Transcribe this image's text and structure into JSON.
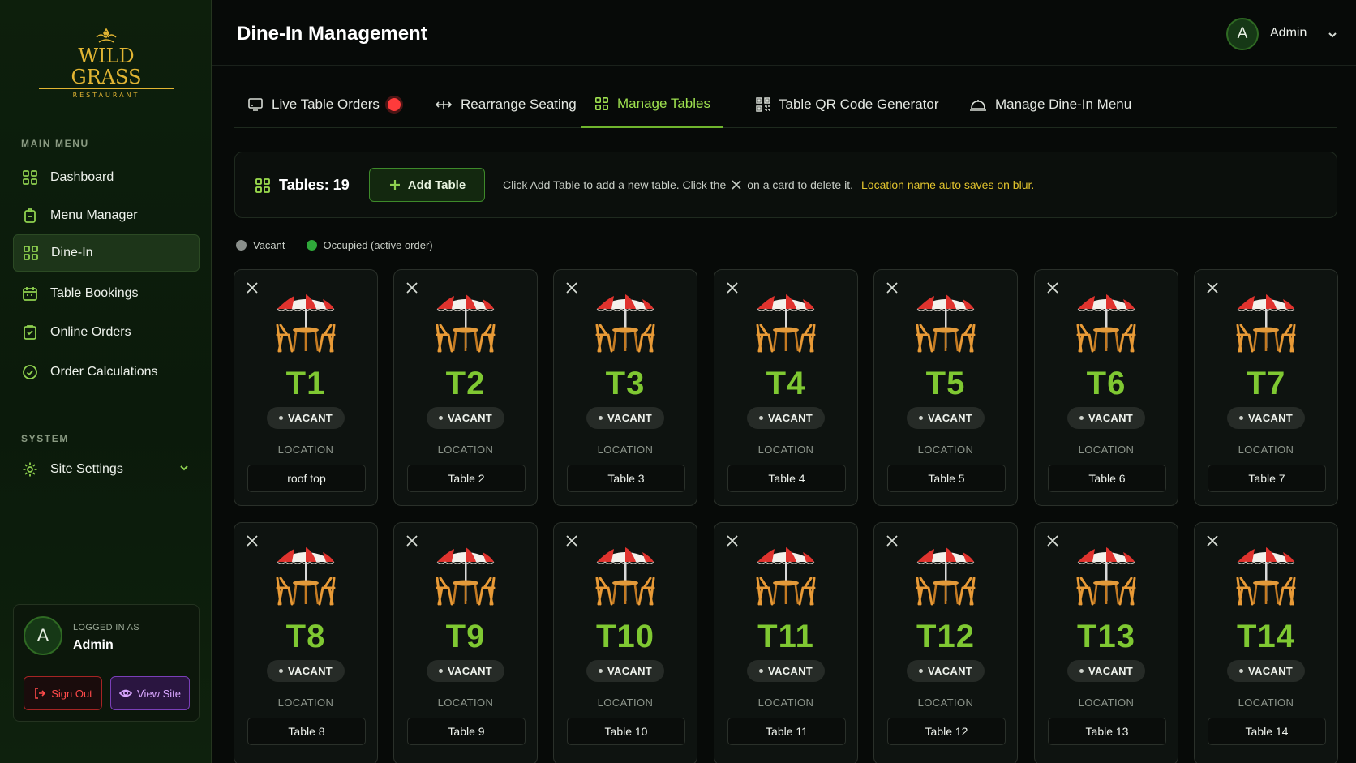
{
  "brand": {
    "name": "WILD GRASS",
    "sub": "RESTAURANT",
    "gold": "#e2b533"
  },
  "sidebar": {
    "main_label": "MAIN MENU",
    "items": [
      {
        "label": "Dashboard",
        "icon": "grid-icon"
      },
      {
        "label": "Menu Manager",
        "icon": "clipboard-icon"
      },
      {
        "label": "Dine-In",
        "icon": "grid-icon",
        "active": true
      },
      {
        "label": "Table Bookings",
        "icon": "calendar-icon"
      },
      {
        "label": "Online Orders",
        "icon": "clipboard-check-icon"
      },
      {
        "label": "Order Calculations",
        "icon": "check-circle-icon"
      }
    ],
    "system_label": "SYSTEM",
    "settings": {
      "label": "Site Settings",
      "icon": "gear-icon"
    },
    "user": {
      "initial": "A",
      "logged_label": "LOGGED IN AS",
      "name": "Admin",
      "signout": "Sign Out",
      "viewsite": "View Site"
    }
  },
  "header": {
    "title": "Dine-In Management",
    "admin_initial": "A",
    "admin_name": "Admin"
  },
  "tabs": [
    {
      "label": "Live Table Orders",
      "icon": "monitor-icon"
    },
    {
      "label": "Rearrange Seating",
      "icon": "arrows-icon"
    },
    {
      "label": "Manage Tables",
      "icon": "grid-icon",
      "active": true
    },
    {
      "label": "Table QR Code Generator",
      "icon": "qr-icon"
    },
    {
      "label": "Manage Dine-In Menu",
      "icon": "cloche-icon"
    }
  ],
  "infobar": {
    "tables_label": "Tables: 19",
    "add_label": "Add Table",
    "help_before": "Click Add Table to add a new table. Click the",
    "help_after": "on a card to delete it.",
    "help_highlight": "Location name auto saves on blur."
  },
  "legend": {
    "vacant": "Vacant",
    "occupied": "Occupied (active order)",
    "vacant_color": "#8a8f8b",
    "occupied_color": "#2fa83a"
  },
  "location_label": "LOCATION",
  "tables": [
    {
      "id": "T1",
      "status": "VACANT",
      "location": "roof top"
    },
    {
      "id": "T2",
      "status": "VACANT",
      "location": "Table 2"
    },
    {
      "id": "T3",
      "status": "VACANT",
      "location": "Table 3"
    },
    {
      "id": "T4",
      "status": "VACANT",
      "location": "Table 4"
    },
    {
      "id": "T5",
      "status": "VACANT",
      "location": "Table 5"
    },
    {
      "id": "T6",
      "status": "VACANT",
      "location": "Table 6"
    },
    {
      "id": "T7",
      "status": "VACANT",
      "location": "Table 7"
    },
    {
      "id": "T8",
      "status": "VACANT",
      "location": "Table 8"
    },
    {
      "id": "T9",
      "status": "VACANT",
      "location": "Table 9"
    },
    {
      "id": "T10",
      "status": "VACANT",
      "location": "Table 10"
    },
    {
      "id": "T11",
      "status": "VACANT",
      "location": "Table 11"
    },
    {
      "id": "T12",
      "status": "VACANT",
      "location": "Table 12"
    },
    {
      "id": "T13",
      "status": "VACANT",
      "location": "Table 13"
    },
    {
      "id": "T14",
      "status": "VACANT",
      "location": "Table 14"
    }
  ]
}
